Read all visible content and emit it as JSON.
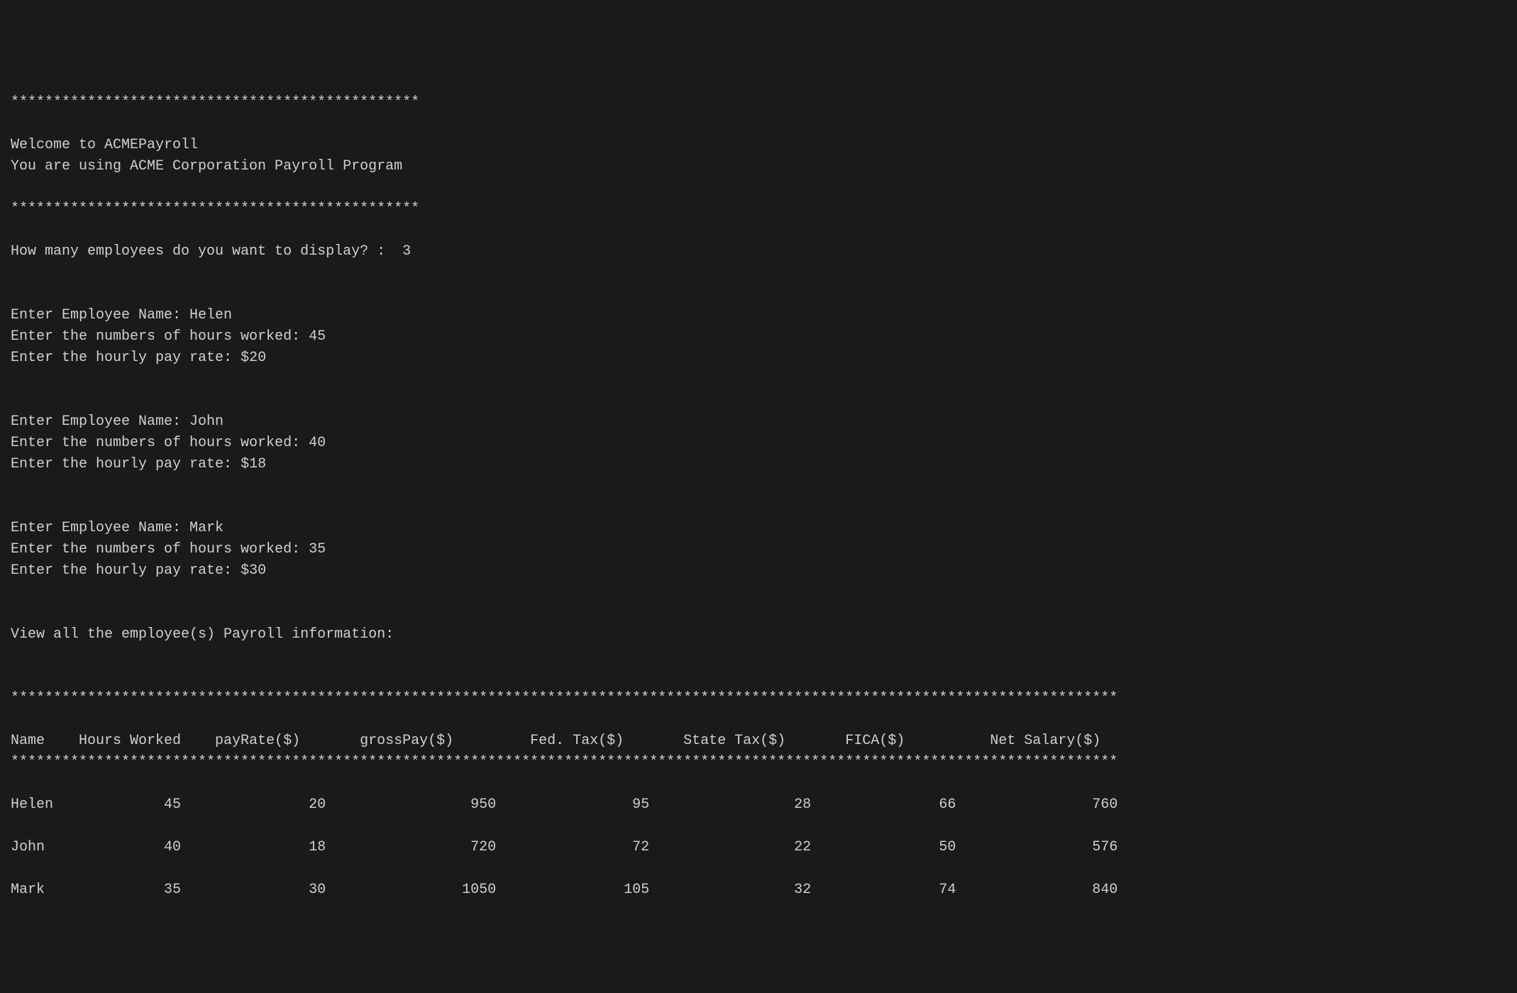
{
  "banner": {
    "stars1": "************************************************",
    "welcome": "Welcome to ACMEPayroll",
    "subtitle": "You are using ACME Corporation Payroll Program",
    "stars2": "************************************************"
  },
  "count_prompt": "How many employees do you want to display? :  ",
  "count_value": "3",
  "employees_input": [
    {
      "name_prompt": "Enter Employee Name: ",
      "name": "Helen",
      "hours_prompt": "Enter the numbers of hours worked: ",
      "hours": "45",
      "rate_prompt": "Enter the hourly pay rate: ",
      "rate": "$20"
    },
    {
      "name_prompt": "Enter Employee Name: ",
      "name": "John",
      "hours_prompt": "Enter the numbers of hours worked: ",
      "hours": "40",
      "rate_prompt": "Enter the hourly pay rate: ",
      "rate": "$18"
    },
    {
      "name_prompt": "Enter Employee Name: ",
      "name": "Mark",
      "hours_prompt": "Enter the numbers of hours worked: ",
      "hours": "35",
      "rate_prompt": "Enter the hourly pay rate: ",
      "rate": "$30"
    }
  ],
  "view_all": "View all the employee(s) Payroll information:",
  "table": {
    "stars_top": "**********************************************************************************************************************************",
    "headers": [
      "Name",
      "Hours Worked",
      "payRate($)",
      "grossPay($)",
      "Fed. Tax($)",
      "State Tax($)",
      "FICA($)",
      "Net Salary($)"
    ],
    "stars_bottom": "**********************************************************************************************************************************",
    "rows": [
      {
        "name": "Helen",
        "hours": "45",
        "payRate": "20",
        "grossPay": "950",
        "fedTax": "95",
        "stateTax": "28",
        "fica": "66",
        "net": "760"
      },
      {
        "name": "John",
        "hours": "40",
        "payRate": "18",
        "grossPay": "720",
        "fedTax": "72",
        "stateTax": "22",
        "fica": "50",
        "net": "576"
      },
      {
        "name": "Mark",
        "hours": "35",
        "payRate": "30",
        "grossPay": "1050",
        "fedTax": "105",
        "stateTax": "32",
        "fica": "74",
        "net": "840"
      }
    ]
  }
}
